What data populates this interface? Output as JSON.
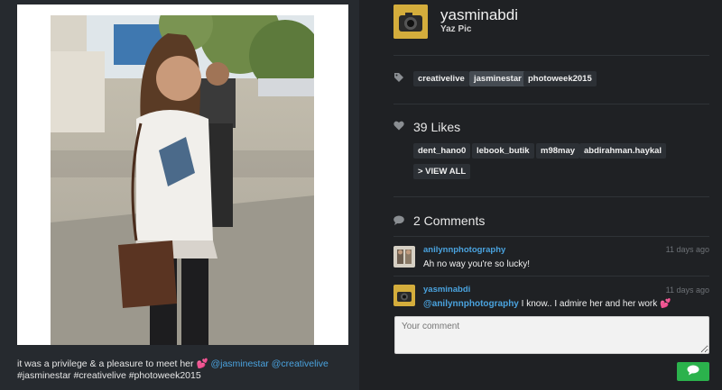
{
  "post": {
    "caption_text": "it was a privilege & a pleasure to meet her",
    "caption_mentions": "@jasminestar @creativelive",
    "caption_hashtags": "#jasminestar #creativelive #photoweek2015",
    "heart_emoji": "💕"
  },
  "user": {
    "username": "yasminabdi",
    "full_name": "Yaz Pic"
  },
  "tags": [
    "creativelive",
    "jasminestar",
    "photoweek2015"
  ],
  "likes": {
    "title": "39 Likes",
    "users": [
      "dent_hano0",
      "lebook_butik",
      "m98may",
      "abdirahman.haykal"
    ],
    "view_all_label": "> VIEW ALL"
  },
  "comments": {
    "title": "2 Comments",
    "items": [
      {
        "user": "anilynnphotography",
        "time": "11 days ago",
        "text": "Ah no way you're so lucky!"
      },
      {
        "user": "yasminabdi",
        "time": "11 days ago",
        "mention": "@anilynnphotography",
        "text": " I know.. I admire her and her work"
      }
    ],
    "placeholder": "Your comment"
  },
  "colors": {
    "accent": "#4aa3df",
    "send": "#2bb24c",
    "heart": "#ff5ea8"
  },
  "icons": {
    "tag": "tag-icon",
    "heart": "heart-icon",
    "comment": "comment-bubble-icon",
    "send": "chat-send-icon"
  }
}
